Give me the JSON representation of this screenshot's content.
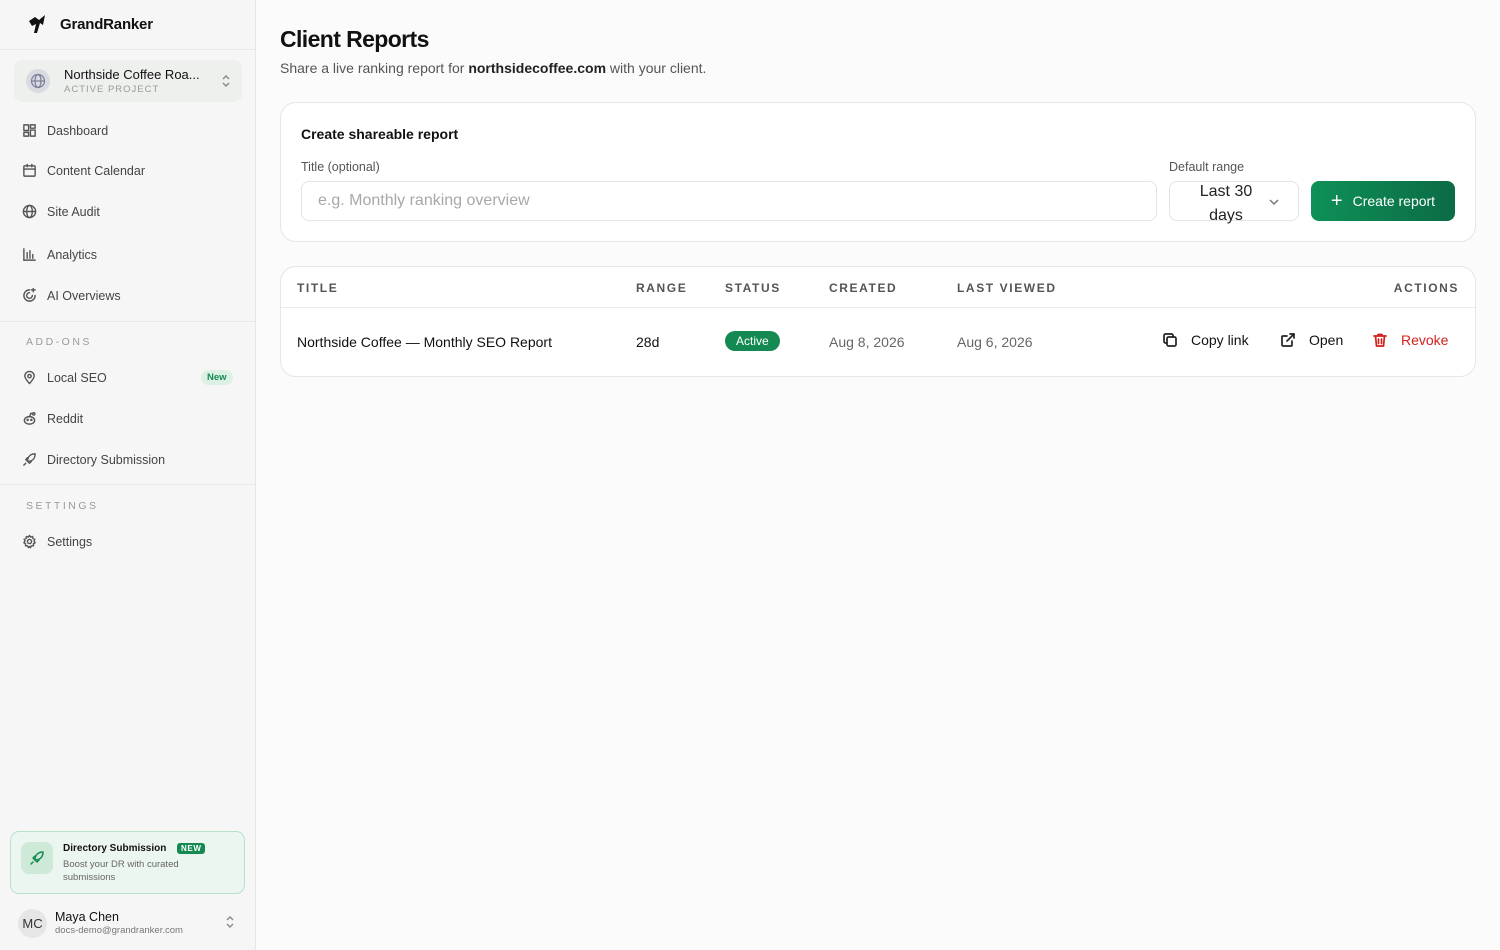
{
  "app": {
    "name": "GrandRanker"
  },
  "project": {
    "name": "Northside Coffee Roa...",
    "sublabel": "ACTIVE PROJECT"
  },
  "nav": {
    "main": [
      {
        "label": "Dashboard",
        "icon": "dashboard-icon"
      },
      {
        "label": "Content Calendar",
        "icon": "calendar-icon"
      },
      {
        "label": "Site Audit",
        "icon": "globe-icon"
      },
      {
        "label": "Analytics",
        "icon": "bar-chart-icon"
      },
      {
        "label": "AI Overviews",
        "icon": "ai-overviews-icon"
      }
    ],
    "addons_label": "ADD-ONS",
    "addons": [
      {
        "label": "Local SEO",
        "icon": "map-pin-icon",
        "badge": "New"
      },
      {
        "label": "Reddit",
        "icon": "reddit-icon"
      },
      {
        "label": "Directory Submission",
        "icon": "rocket-icon"
      }
    ],
    "settings_label": "SETTINGS",
    "settings": [
      {
        "label": "Settings",
        "icon": "gear-icon"
      }
    ]
  },
  "promo": {
    "title": "Directory Submission",
    "badge": "NEW",
    "description": "Boost your DR with curated submissions"
  },
  "user": {
    "initials": "MC",
    "name": "Maya Chen",
    "email": "docs-demo@grandranker.com"
  },
  "page": {
    "title": "Client Reports",
    "subtitle_prefix": "Share a live ranking report for ",
    "subtitle_domain": "northsidecoffee.com",
    "subtitle_suffix": " with your client."
  },
  "create_form": {
    "heading": "Create shareable report",
    "title_label": "Title (optional)",
    "title_placeholder": "e.g. Monthly ranking overview",
    "title_value": "",
    "range_label": "Default range",
    "range_value": "Last 30 days",
    "submit_label": "Create report"
  },
  "table": {
    "columns": {
      "title": "TITLE",
      "range": "RANGE",
      "status": "STATUS",
      "created": "CREATED",
      "last_viewed": "LAST VIEWED",
      "actions": "ACTIONS"
    },
    "rows": [
      {
        "title": "Northside Coffee — Monthly SEO Report",
        "range": "28d",
        "status": "Active",
        "created": "Aug 8, 2026",
        "last_viewed": "Aug 6, 2026",
        "actions": {
          "copy": "Copy link",
          "open": "Open",
          "revoke": "Revoke"
        }
      }
    ]
  },
  "colors": {
    "accent": "#148a52",
    "danger": "#d0221d",
    "sidebar_bg": "#f6f6f6",
    "page_bg": "#fbfbfb"
  }
}
